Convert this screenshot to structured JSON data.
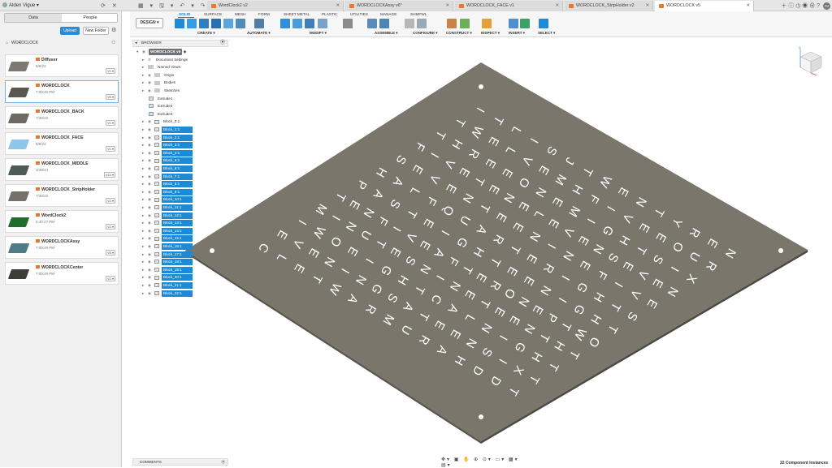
{
  "topbar": {
    "user_name": "Alden Vigue",
    "tabs": [
      {
        "label": "WordClock2 v2",
        "active": false
      },
      {
        "label": "WORDCLOCKAssy v6*",
        "active": false
      },
      {
        "label": "WORDCLOCK_FACE v1",
        "active": false
      },
      {
        "label": "WORDCLOCK_StripHolder v2",
        "active": false
      },
      {
        "label": "WORDCLOCK v5",
        "active": true
      }
    ],
    "avatar": "AV"
  },
  "data_panel": {
    "tab_data": "Data",
    "tab_people": "People",
    "upload": "Upload",
    "new_folder": "New Folder",
    "breadcrumb": "WORDCLOCK",
    "files": [
      {
        "name": "Diffuser",
        "date": "8/9/23",
        "version": "V1",
        "thumb": "#7d7870"
      },
      {
        "name": "WORDCLOCK",
        "date": "7:00:46 PM",
        "version": "V5",
        "thumb": "#5a5650"
      },
      {
        "name": "WORDCLOCK_BACK",
        "date": "7/30/23",
        "version": "V1",
        "thumb": "#6e6a62"
      },
      {
        "name": "WORDCLOCK_FACE",
        "date": "8/9/23",
        "version": "V1",
        "thumb": "#8cc7ea"
      },
      {
        "name": "WORDCLOCK_MIDDLE",
        "date": "3/28/24",
        "version": "V10",
        "thumb": "#4d5a58"
      },
      {
        "name": "WORDCLOCK_StripHolder",
        "date": "7/30/23",
        "version": "V2",
        "thumb": "#74706a"
      },
      {
        "name": "WordClock2",
        "date": "6:40:27 PM",
        "version": "V2",
        "thumb": "#1f6e2a"
      },
      {
        "name": "WORDCLOCKAssy",
        "date": "7:00:49 PM",
        "version": "V6",
        "thumb": "#4f7a86"
      },
      {
        "name": "WORDCLOCKCenter",
        "date": "7:00:49 PM",
        "version": "V2",
        "thumb": "#3e3c38"
      }
    ]
  },
  "toolbar": {
    "workspace": "DESIGN",
    "tabs": [
      "SOLID",
      "SURFACE",
      "MESH",
      "FORM",
      "SHEET METAL",
      "PLASTIC",
      "UTILITIES",
      "MANAGE",
      "SHMFWL"
    ],
    "groups": [
      "CREATE",
      "AUTOMATE",
      "MODIFY",
      "ASSEMBLE",
      "CONFIGURE",
      "CONSTRUCT",
      "INSPECT",
      "INSERT",
      "SELECT"
    ]
  },
  "browser": {
    "title": "BROWSER",
    "root": "WORDCLOCK v5",
    "items": [
      {
        "label": "Document Settings",
        "kind": "gear"
      },
      {
        "label": "Named Views",
        "kind": "folder"
      },
      {
        "label": "Origin",
        "kind": "folder"
      },
      {
        "label": "Bodies",
        "kind": "folder"
      },
      {
        "label": "Sketches",
        "kind": "folder"
      },
      {
        "label": "Extrude1",
        "kind": "feature"
      },
      {
        "label": "Extrude2",
        "kind": "feature"
      },
      {
        "label": "Extrude3",
        "kind": "feature"
      },
      {
        "label": "Block_0:1",
        "kind": "comp"
      }
    ],
    "blocks": [
      "Block_1:1",
      "Block_2:1",
      "Block_3:1",
      "Block_4:1",
      "Block_5:1",
      "Block_6:1",
      "Block_7:1",
      "Block_8:1",
      "Block_9:1",
      "Block_10:1",
      "Block_11:1",
      "Block_12:1",
      "Block_13:1",
      "Block_14:1",
      "Block_15:1",
      "Block_16:1",
      "Block_17:1",
      "Block_18:1",
      "Block_19:1",
      "Block_20:1",
      "Block_21:1",
      "Block_22:1"
    ]
  },
  "viewport": {
    "plate_color": "#7a766c",
    "letters": [
      "ITLISJTWENTYREN",
      "TWELVEMHFIVEEOUR",
      "THREEONEMIGHTSIX",
      "FIVETENELEVENSEVEN",
      "SEVENTEENINEFIVE",
      "HALFQUARTERIGHTS",
      "PASTEIGHTEENIGHT",
      "TENFIVEAFTERONEPTWO",
      "MINUTESNINETEENTHT",
      "IWOEIGHTCALNIGHT",
      "EVENINGSATEENSIXT",
      "CLETWARMURAHDDT"
    ]
  },
  "comments_label": "COMMENTS",
  "status": "22 Component Instances"
}
